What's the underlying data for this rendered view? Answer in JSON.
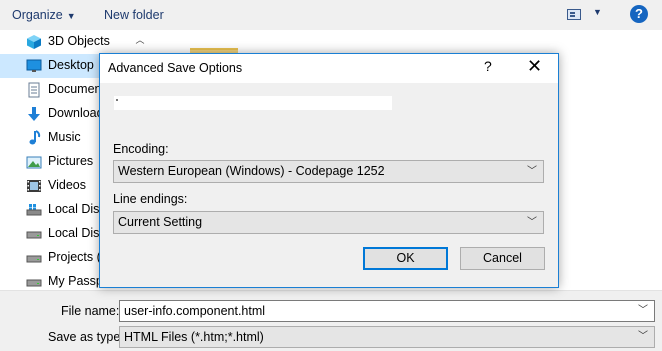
{
  "toolbar": {
    "organize_label": "Organize",
    "new_folder_label": "New folder",
    "view_icon": "view-options-icon",
    "help_label": "?"
  },
  "nav": {
    "items": [
      {
        "label": "3D Objects",
        "icon": "cube-icon"
      },
      {
        "label": "Desktop",
        "icon": "desktop-icon",
        "selected": true
      },
      {
        "label": "Documen",
        "icon": "document-icon"
      },
      {
        "label": "Download",
        "icon": "download-arrow-icon"
      },
      {
        "label": "Music",
        "icon": "music-note-icon"
      },
      {
        "label": "Pictures",
        "icon": "pictures-icon"
      },
      {
        "label": "Videos",
        "icon": "film-icon"
      },
      {
        "label": "Local Disk",
        "icon": "drive-windows-icon"
      },
      {
        "label": "Local Disk",
        "icon": "drive-icon"
      },
      {
        "label": "Projects (I",
        "icon": "drive-icon"
      },
      {
        "label": "My Passp",
        "icon": "drive-icon"
      }
    ]
  },
  "bottom": {
    "filename_label": "File name:",
    "filename_value": "user-info.component.html",
    "savetype_label": "Save as type:",
    "savetype_value": "HTML Files (*.htm;*.html)"
  },
  "modal": {
    "title": "Advanced Save Options",
    "help_label": "?",
    "close_label": "✕",
    "encoding_label": "Encoding:",
    "encoding_value": "Western European (Windows) - Codepage 1252",
    "line_endings_label": "Line endings:",
    "line_endings_value": "Current Setting",
    "ok_label": "OK",
    "cancel_label": "Cancel"
  },
  "colors": {
    "accent": "#0078d7",
    "selected_bg": "#cce8ff",
    "dialog_bg": "#f0f0f0"
  }
}
